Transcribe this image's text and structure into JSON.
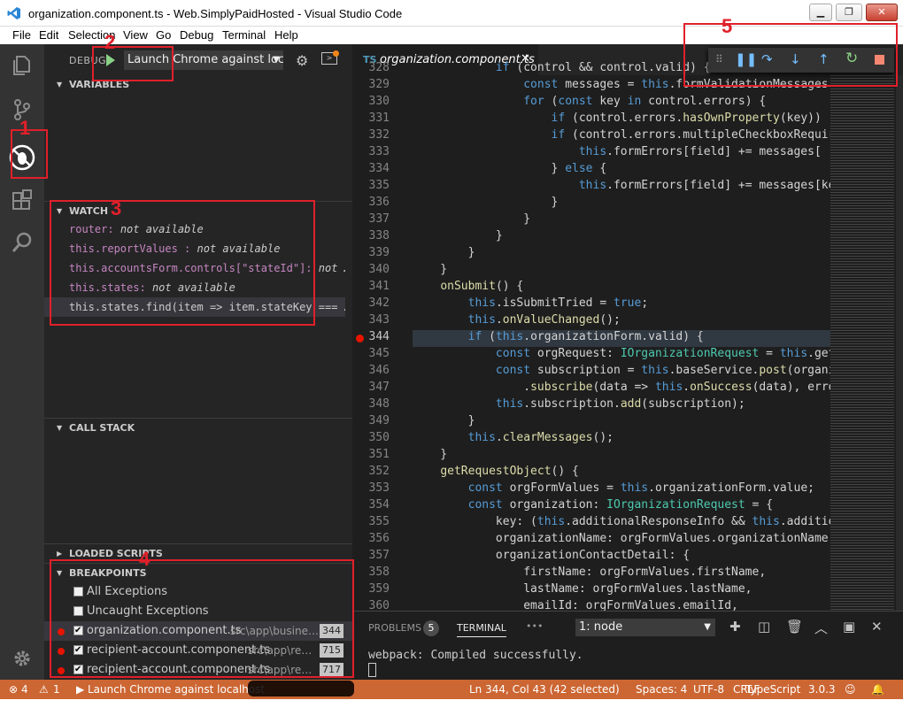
{
  "window": {
    "title": "organization.component.ts - Web.SimplyPaidHosted - Visual Studio Code",
    "controls": [
      "minimize",
      "maximize",
      "close"
    ]
  },
  "menu": [
    "File",
    "Edit",
    "Selection",
    "View",
    "Go",
    "Debug",
    "Terminal",
    "Help"
  ],
  "activity_bar": {
    "items": [
      "explorer-icon",
      "source-control-icon",
      "debug-icon",
      "extensions-icon",
      "search-icon"
    ],
    "settings": "gear-icon"
  },
  "debug_toolbar_top": {
    "label": "DEBUG",
    "config": "Launch Chrome against loc"
  },
  "sidebar": {
    "variables": "VARIABLES",
    "watch": {
      "title": "WATCH",
      "items": [
        {
          "expr": "router:",
          "value": "not available"
        },
        {
          "expr": "this.reportValues :",
          "value": "not available"
        },
        {
          "expr": "this.accountsForm.controls[\"stateId\"]:",
          "value": "not …"
        },
        {
          "expr": "this.states:",
          "value": "not available"
        },
        {
          "expr": "this.states.find(item => item.stateKey === …",
          "value": ""
        }
      ]
    },
    "call_stack": "CALL STACK",
    "loaded_scripts": "LOADED SCRIPTS",
    "breakpoints": {
      "title": "BREAKPOINTS",
      "options": [
        "All Exceptions",
        "Uncaught Exceptions"
      ],
      "items": [
        {
          "file": "organization.component.ts",
          "path": "src\\app\\busine…",
          "line": "344"
        },
        {
          "file": "recipient-account.component.ts",
          "path": "src\\app\\re…",
          "line": "715"
        },
        {
          "file": "recipient-account.component.ts",
          "path": "src\\app\\re…",
          "line": "717"
        }
      ]
    }
  },
  "editor": {
    "tab": {
      "lang": "TS",
      "name": "organization.component.ts"
    },
    "lines": [
      {
        "n": "328",
        "code": "            if (control && control.valid) {"
      },
      {
        "n": "329",
        "code": "                const messages = this.formValidationMessages["
      },
      {
        "n": "330",
        "code": "                for (const key in control.errors) {"
      },
      {
        "n": "331",
        "code": "                    if (control.errors.hasOwnProperty(key))"
      },
      {
        "n": "332",
        "code": "                    if (control.errors.multipleCheckboxRequire"
      },
      {
        "n": "333",
        "code": "                        this.formErrors[field] += messages["
      },
      {
        "n": "334",
        "code": "                    } else {"
      },
      {
        "n": "335",
        "code": "                        this.formErrors[field] += messages[ke"
      },
      {
        "n": "336",
        "code": "                    }"
      },
      {
        "n": "337",
        "code": "                }"
      },
      {
        "n": "338",
        "code": "            }"
      },
      {
        "n": "339",
        "code": "        }"
      },
      {
        "n": "340",
        "code": "    }"
      },
      {
        "n": "341",
        "code": "    onSubmit() {"
      },
      {
        "n": "342",
        "code": "        this.isSubmitTried = true;"
      },
      {
        "n": "343",
        "code": "        this.onValueChanged();"
      },
      {
        "n": "344",
        "code": "        if (this.organizationForm.valid) {"
      },
      {
        "n": "345",
        "code": "            const orgRequest: IOrganizationRequest = this.getR"
      },
      {
        "n": "346",
        "code": "            const subscription = this.baseService.post(organi"
      },
      {
        "n": "347",
        "code": "                .subscribe(data => this.onSuccess(data), error"
      },
      {
        "n": "348",
        "code": "            this.subscription.add(subscription);"
      },
      {
        "n": "349",
        "code": "        }"
      },
      {
        "n": "350",
        "code": "        this.clearMessages();"
      },
      {
        "n": "351",
        "code": "    }"
      },
      {
        "n": "352",
        "code": "    getRequestObject() {"
      },
      {
        "n": "353",
        "code": "        const orgFormValues = this.organizationForm.value;"
      },
      {
        "n": "354",
        "code": "        const organization: IOrganizationRequest = {"
      },
      {
        "n": "355",
        "code": "            key: (this.additionalResponseInfo && this.additio"
      },
      {
        "n": "356",
        "code": "            organizationName: orgFormValues.organizationName,"
      },
      {
        "n": "357",
        "code": "            organizationContactDetail: {"
      },
      {
        "n": "358",
        "code": "                firstName: orgFormValues.firstName,"
      },
      {
        "n": "359",
        "code": "                lastName: orgFormValues.lastName,"
      },
      {
        "n": "360",
        "code": "                emailId: orgFormValues.emailId,"
      }
    ],
    "breakpoint_line": "344"
  },
  "debug_controls": [
    "drag-handle-icon",
    "pause-icon",
    "step-over-icon",
    "step-into-icon",
    "step-out-icon",
    "restart-icon",
    "stop-icon"
  ],
  "panel": {
    "tabs": [
      "PROBLEMS",
      "TERMINAL"
    ],
    "problems_count": "5",
    "more": "•••",
    "terminal_select": "1: node",
    "output": "webpack: Compiled successfully."
  },
  "status_bar": {
    "errors": "4",
    "warnings": "1",
    "launch": "Launch Chrome against localhost",
    "position": "Ln 344, Col 43 (42 selected)",
    "spaces": "Spaces: 4",
    "encoding": "UTF-8",
    "eol": "CRLF",
    "language": "TypeScript",
    "version": "3.0.3"
  },
  "annotations": [
    "1",
    "2",
    "3",
    "4",
    "5"
  ],
  "colors": {
    "status_bar": "#cc6633",
    "annotation": "#e0202a",
    "breakpoint": "#e51400",
    "activity_bar": "#333333",
    "sidebar": "#252526",
    "editor": "#1e1e1e"
  }
}
